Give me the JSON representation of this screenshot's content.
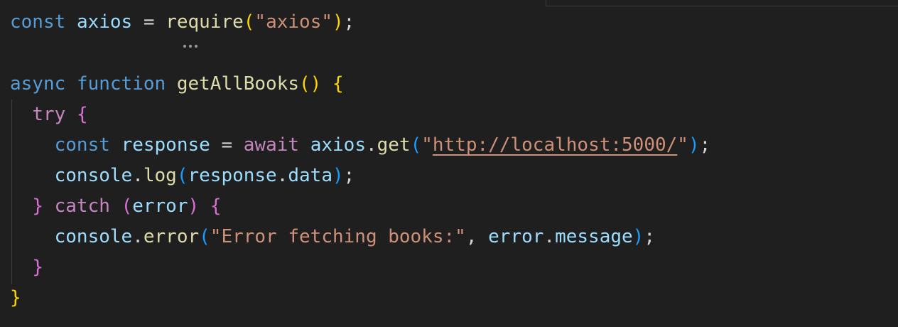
{
  "editor": {
    "language": "javascript",
    "theme_colors": {
      "background": "#1f1f1f",
      "keyword": "#569cd6",
      "control": "#c586c0",
      "variable": "#9cdcfe",
      "function": "#dcdcaa",
      "string": "#ce9178",
      "bracket_level1": "#ffd700",
      "bracket_level2": "#da70d6",
      "bracket_level3": "#179fff"
    },
    "code": {
      "l1": {
        "kw": "const",
        "var": "axios",
        "eq": "=",
        "fn": "require",
        "open": "(",
        "str": "\"axios\"",
        "close": ")",
        "semi": ";"
      },
      "l3": {
        "kw1": "async",
        "kw2": "function",
        "fn": "getAllBooks",
        "parens": "()",
        "brace": "{"
      },
      "l4": {
        "kw": "try",
        "brace": "{"
      },
      "l5": {
        "kw": "const",
        "var": "response",
        "eq": "=",
        "await": "await",
        "obj": "axios",
        "dot": ".",
        "fn": "get",
        "open": "(",
        "q1": "\"",
        "url": "http://localhost:5000/",
        "q2": "\"",
        "close": ")",
        "semi": ";"
      },
      "l6": {
        "obj": "console",
        "dot": ".",
        "fn": "log",
        "open": "(",
        "var1": "response",
        "dot2": ".",
        "var2": "data",
        "close": ")",
        "semi": ";"
      },
      "l7": {
        "brace1": "}",
        "kw": "catch",
        "open": "(",
        "var": "error",
        "close": ")",
        "brace2": "{"
      },
      "l8": {
        "obj": "console",
        "dot": ".",
        "fn": "error",
        "open": "(",
        "str": "\"Error fetching books:\"",
        "comma": ",",
        "var1": "error",
        "dot2": ".",
        "var2": "message",
        "close": ")",
        "semi": ";"
      },
      "l9": {
        "brace": "}"
      },
      "l10": {
        "brace": "}"
      }
    }
  }
}
